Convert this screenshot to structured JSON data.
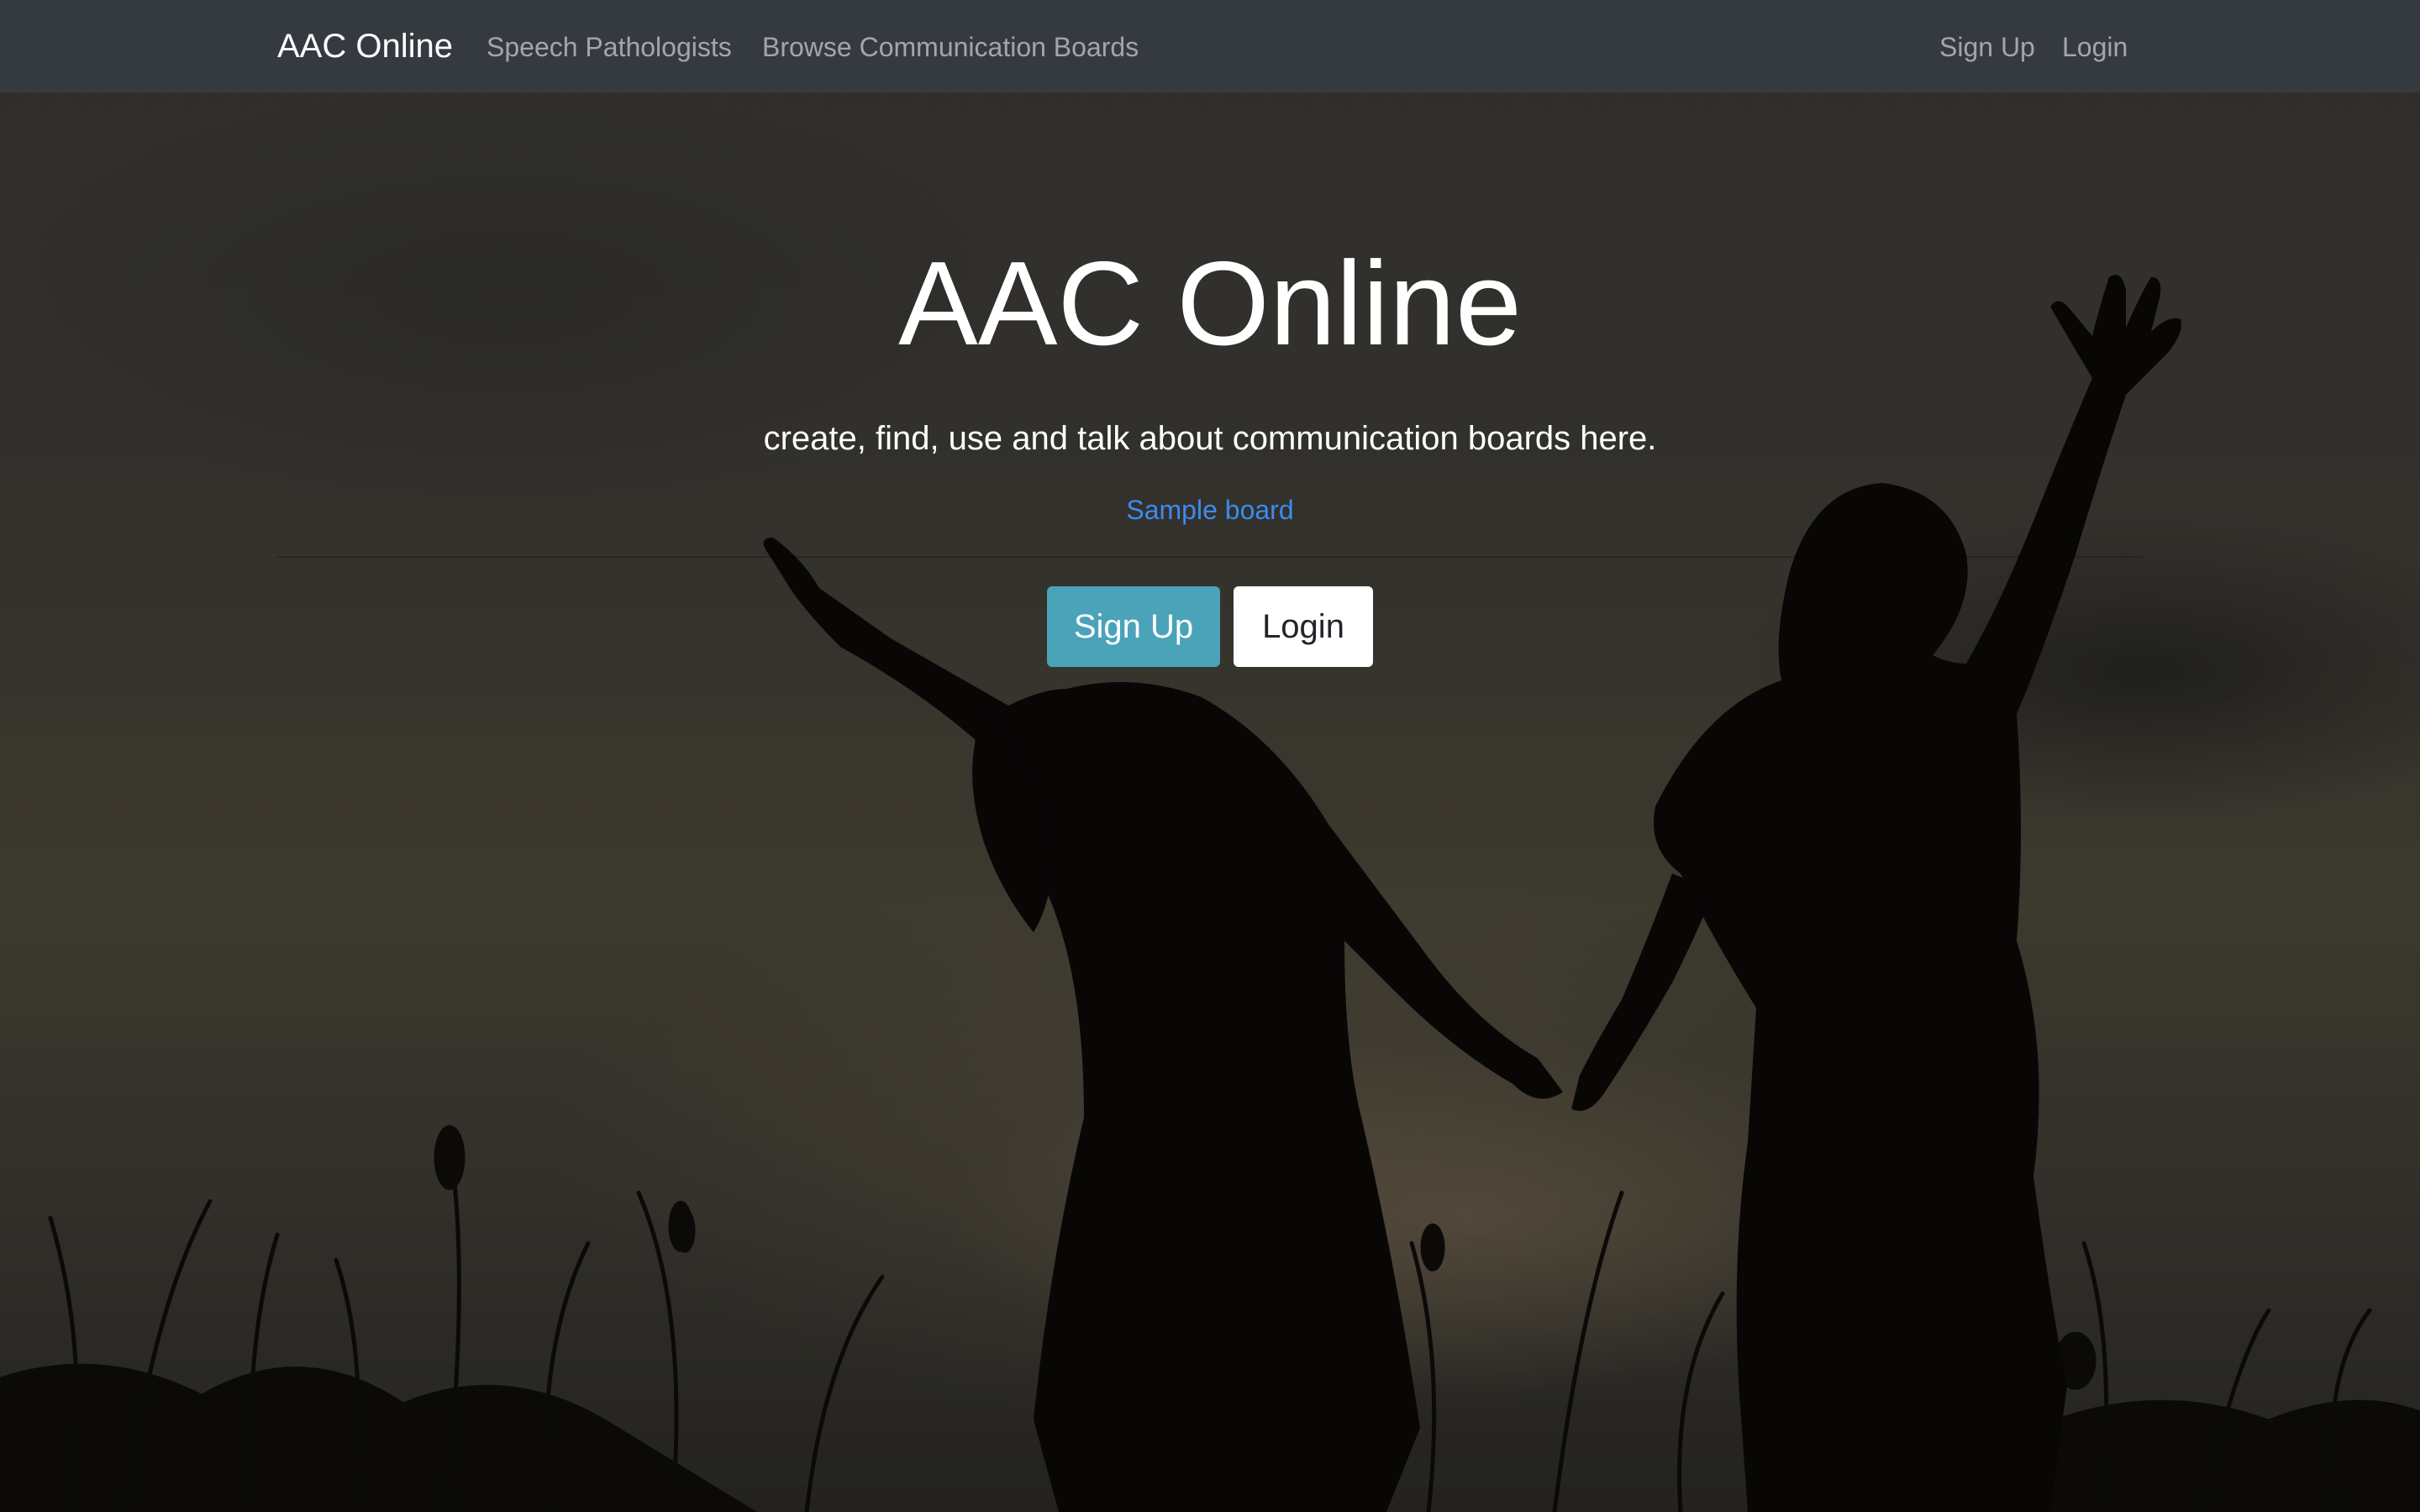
{
  "navbar": {
    "brand": "AAC Online",
    "links": [
      {
        "label": "Speech Pathologists"
      },
      {
        "label": "Browse Communication Boards"
      }
    ],
    "right_links": [
      {
        "label": "Sign Up"
      },
      {
        "label": "Login"
      }
    ]
  },
  "hero": {
    "title": "AAC Online",
    "lead": "create, find, use and talk about communication boards here.",
    "sample_link": "Sample board",
    "signup_button": "Sign Up",
    "login_button": "Login"
  },
  "colors": {
    "navbar_bg": "#343a40",
    "link_color": "#3b8bf0",
    "signup_button_bg": "#4aa3b8",
    "login_button_bg": "#ffffff"
  }
}
